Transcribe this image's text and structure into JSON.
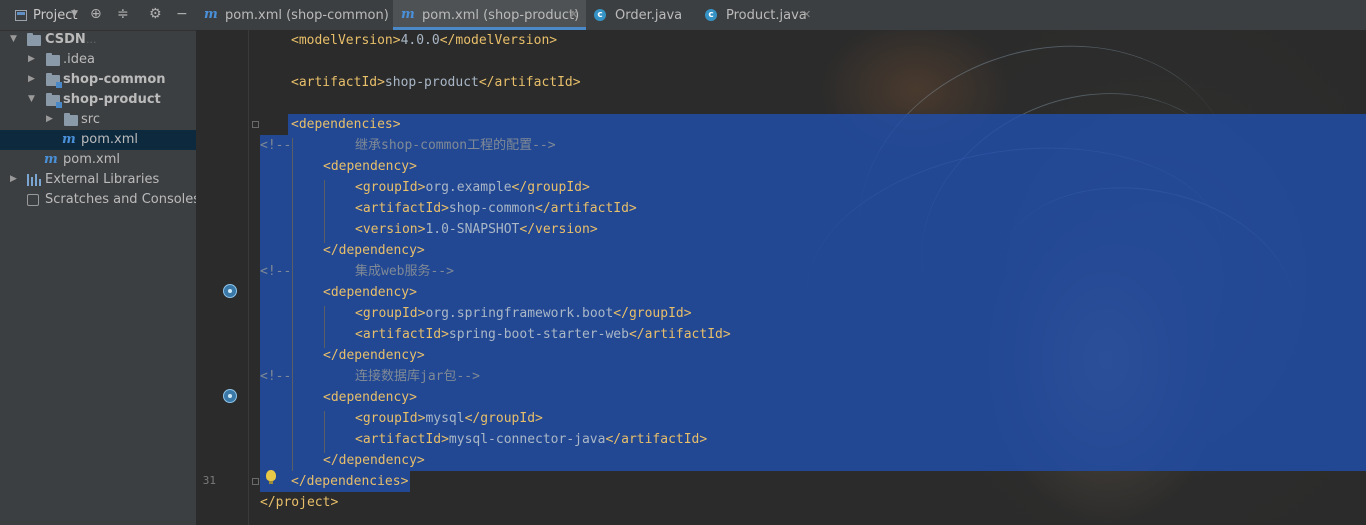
{
  "sidebar": {
    "header": {
      "title": "Project",
      "icons": [
        "project-icon",
        "chevron-down-icon",
        "crosshair-icon",
        "collapse-icon",
        "gear-icon",
        "minimize-icon"
      ]
    },
    "items": [
      {
        "label": "CSDN",
        "hint": "...",
        "level": 0,
        "expanded": true,
        "icon": "folder-icon",
        "bold": true
      },
      {
        "label": ".idea",
        "level": 1,
        "expanded": false,
        "icon": "folder-icon"
      },
      {
        "label": "shop-common",
        "level": 1,
        "expanded": false,
        "icon": "module-folder-icon",
        "bold": true
      },
      {
        "label": "shop-product",
        "level": 1,
        "expanded": true,
        "icon": "module-folder-icon",
        "bold": true
      },
      {
        "label": "src",
        "level": 2,
        "expanded": false,
        "icon": "folder-icon"
      },
      {
        "label": "pom.xml",
        "level": 2,
        "icon": "maven-icon",
        "selected": true
      },
      {
        "label": "pom.xml",
        "level": 1,
        "icon": "maven-icon"
      },
      {
        "label": "External Libraries",
        "level": 0,
        "expanded": false,
        "icon": "library-icon"
      },
      {
        "label": "Scratches and Consoles",
        "level": 0,
        "icon": "scratch-icon"
      }
    ]
  },
  "tabs": [
    {
      "label": "pom.xml (shop-common)",
      "icon": "maven-icon",
      "active": false
    },
    {
      "label": "pom.xml (shop-product)",
      "icon": "maven-icon",
      "active": true
    },
    {
      "label": "Order.java",
      "icon": "class-icon",
      "active": false
    },
    {
      "label": "Product.java",
      "icon": "class-icon",
      "active": false
    }
  ],
  "editor": {
    "current_line_number": "31",
    "lines": {
      "model_open": "<modelVersion>",
      "model_val": "4.0.0",
      "model_close": "</modelVersion>",
      "artifact_open": "<artifactId>",
      "artifact_val": "shop-product",
      "artifact_close": "</artifactId>",
      "deps_open": "<dependencies>",
      "c1_start": "<!--",
      "c1_text": "继承shop-common工程的配置-->",
      "dep_open": "<dependency>",
      "g_open": "<groupId>",
      "g_close": "</groupId>",
      "a_open": "<artifactId>",
      "a_close": "</artifactId>",
      "v_open": "<version>",
      "v_close": "</version>",
      "dep_close": "</dependency>",
      "d1_group": "org.example",
      "d1_artifact": "shop-common",
      "d1_version": "1.0-SNAPSHOT",
      "c2_start": "<!--",
      "c2_text": "集成web服务-->",
      "d2_group": "org.springframework.boot",
      "d2_artifact": "spring-boot-starter-web",
      "c3_start": "<!--",
      "c3_text": "连接数据库jar包-->",
      "d3_group": "mysql",
      "d3_artifact": "mysql-connector-java",
      "deps_close": "</dependencies>",
      "project_close": "</project>"
    }
  },
  "colors": {
    "tag": "#e8bf6a",
    "text": "#a9b7c6",
    "comment": "#7f8a96",
    "selection": "#214fae",
    "accent": "#4a88c7"
  }
}
